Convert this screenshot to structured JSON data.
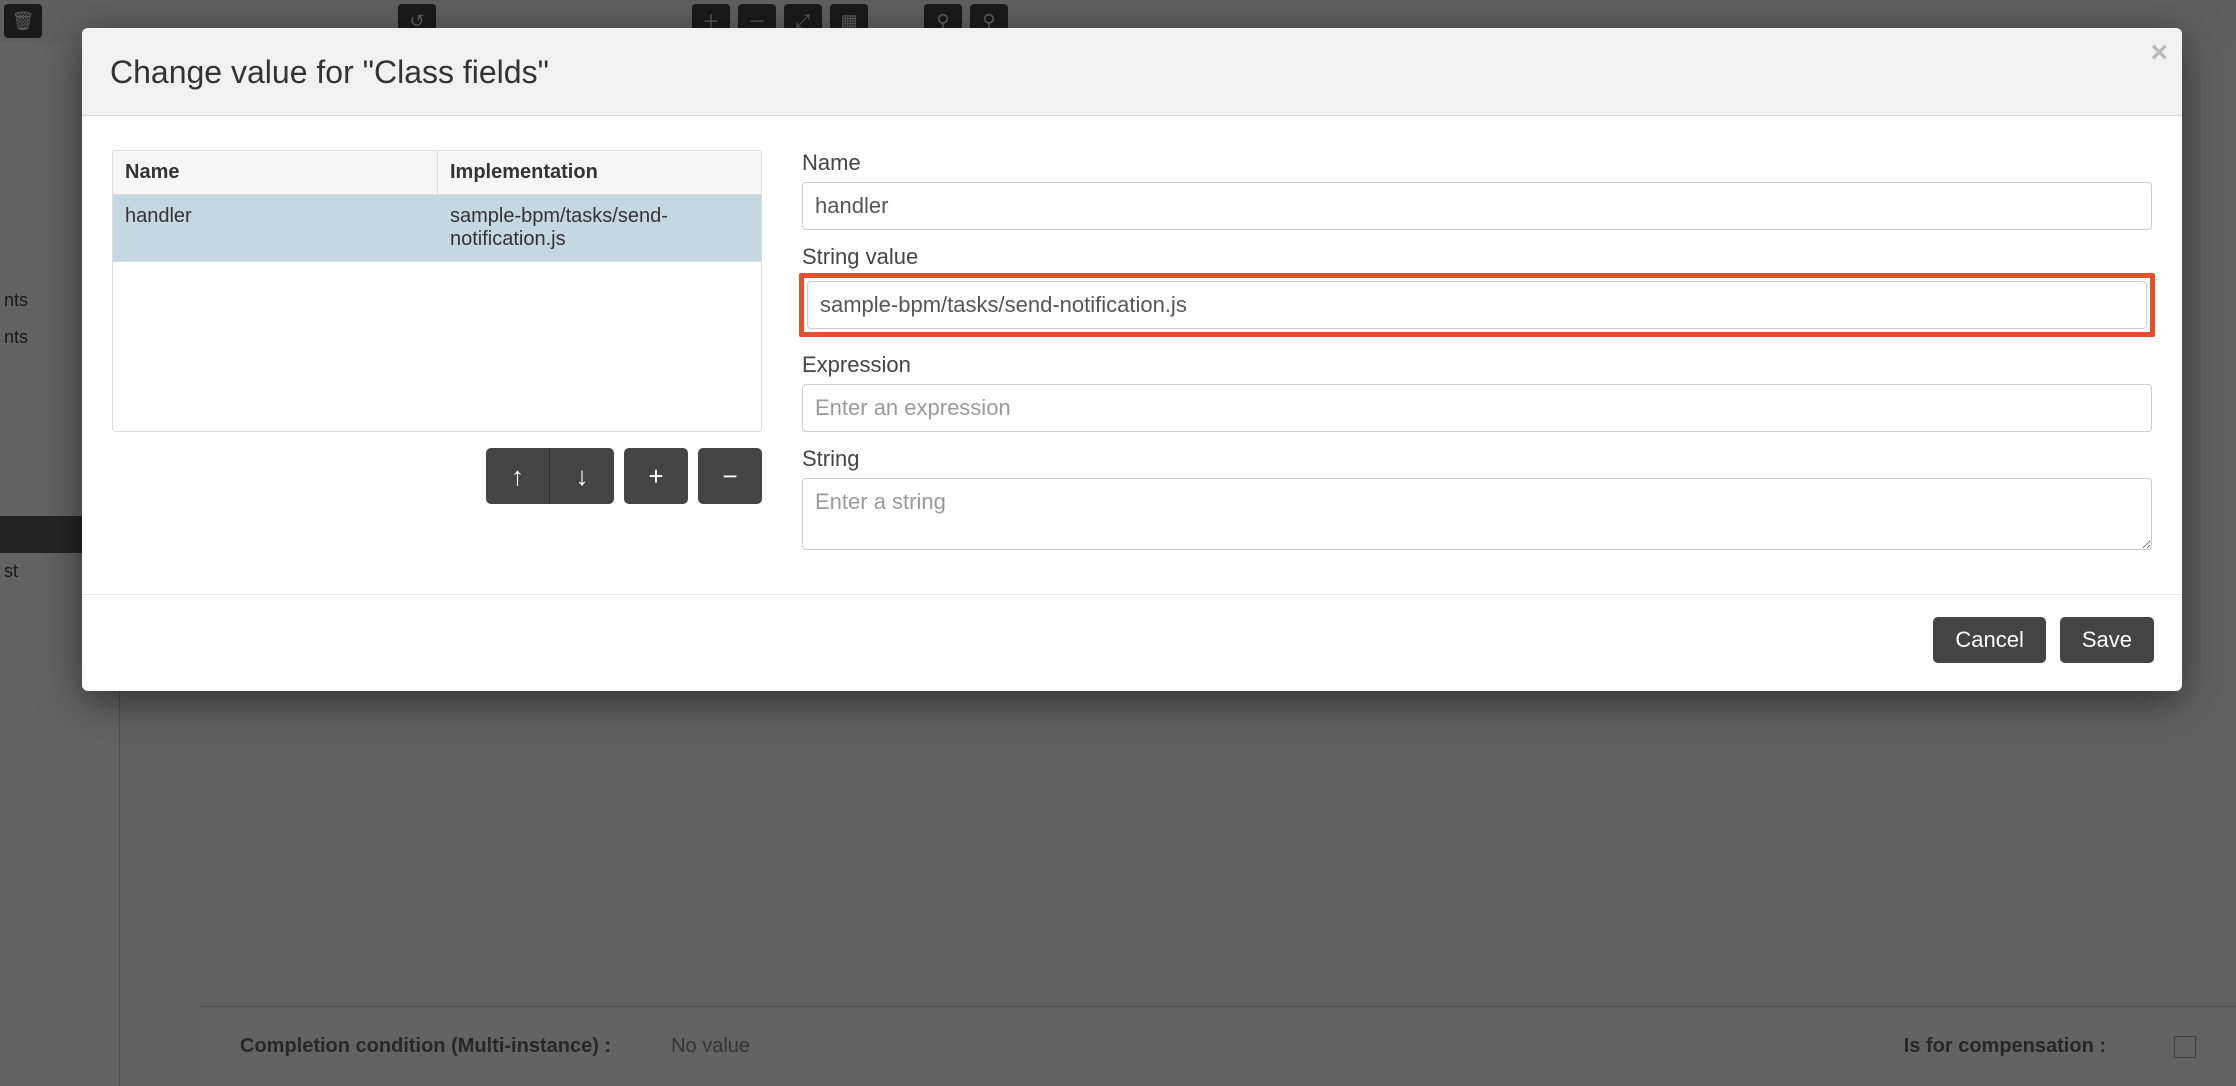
{
  "modal": {
    "title": "Change value for \"Class fields\"",
    "close_icon": "×"
  },
  "table": {
    "headers": {
      "name": "Name",
      "impl": "Implementation"
    },
    "rows": [
      {
        "name": "handler",
        "impl": "sample-bpm/tasks/send-notification.js"
      }
    ]
  },
  "actions": {
    "up": "↑",
    "down": "↓",
    "add": "+",
    "remove": "−"
  },
  "form": {
    "name_label": "Name",
    "name_value": "handler",
    "string_value_label": "String value",
    "string_value_value": "sample-bpm/tasks/send-notification.js",
    "expression_label": "Expression",
    "expression_placeholder": "Enter an expression",
    "string_label": "String",
    "string_placeholder": "Enter a string"
  },
  "footer": {
    "cancel": "Cancel",
    "save": "Save"
  },
  "background": {
    "sidebar": {
      "items": [
        "nts",
        "nts",
        "",
        "st"
      ]
    },
    "bottom": {
      "label1": "Completion condition (Multi-instance)  :",
      "value1": "No value",
      "label2": "Is for compensation  :"
    },
    "toolbar_icons": [
      "trash",
      "",
      "undo",
      "",
      "",
      "",
      "zoom-in",
      "zoom-out",
      "zoom-fit",
      "layout",
      "",
      "link1",
      "link2"
    ]
  }
}
